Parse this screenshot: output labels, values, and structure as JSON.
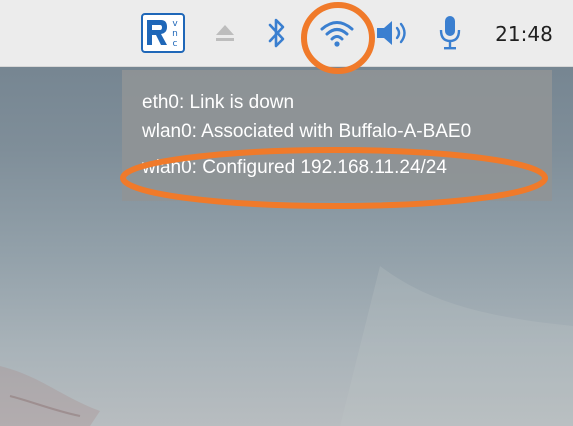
{
  "panel": {
    "tray_icons": [
      {
        "name": "vnc-icon",
        "label_lines": [
          "v",
          "n",
          "c"
        ]
      },
      {
        "name": "eject-icon"
      },
      {
        "name": "bluetooth-icon"
      },
      {
        "name": "wifi-icon"
      },
      {
        "name": "volume-icon"
      },
      {
        "name": "microphone-icon"
      }
    ],
    "clock": "21:48"
  },
  "tooltip": {
    "lines": [
      "eth0: Link is down",
      "wlan0: Associated with Buffalo-A-BAE0",
      "wlan0: Configured 192.168.11.24/24"
    ]
  },
  "colors": {
    "panel_bg": "#ececec",
    "icon_blue": "#3a7fd0",
    "annotation_orange": "#f07a2a",
    "tooltip_bg": "#8f9496"
  }
}
